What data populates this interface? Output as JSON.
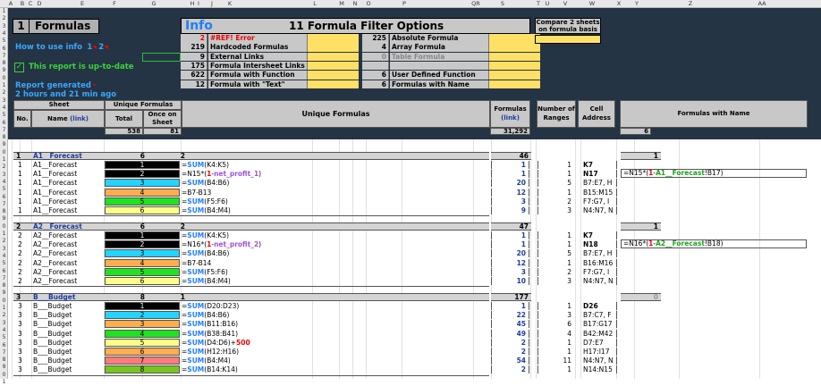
{
  "col_headers": [
    "A",
    "B",
    "C",
    "D",
    "E",
    "F",
    "G",
    "H",
    "I",
    "J",
    "K",
    "L",
    "M",
    "N",
    "O",
    "P",
    "QR",
    "S",
    "T",
    "U",
    "V",
    "W",
    "X",
    "Y",
    "Z",
    "AA"
  ],
  "row_headers": [
    "1",
    "2",
    "3",
    "4",
    "5",
    "6",
    "7",
    "8",
    "9",
    "0",
    "1",
    "2",
    "3",
    "4",
    "5",
    "6",
    "7",
    "8",
    "9",
    "0",
    "1",
    "2",
    "3",
    "4",
    "5",
    "6",
    "7",
    "8",
    "9",
    "0",
    "1",
    "2",
    "3",
    "4",
    "5",
    "6",
    "7",
    "8",
    "9",
    "0",
    "1",
    "2",
    "3",
    "4",
    "5",
    "6",
    "7",
    "8",
    "9",
    "0",
    "1"
  ],
  "title": {
    "number": "1",
    "text": "Formulas"
  },
  "how_to": {
    "label": "How to use info",
    "link1": "1",
    "link2": "2"
  },
  "status": {
    "check": "✓",
    "text": "This report is up-to-date"
  },
  "generated": {
    "line1": "Report generated",
    "line2": "2 hours and 21 min ago"
  },
  "info": {
    "icon": "Info",
    "title": "11 Formula Filter Options"
  },
  "filters_left": [
    {
      "count": "2",
      "label": "#REF! Error",
      "red": true
    },
    {
      "count": "219",
      "label": "Hardcoded Formulas"
    },
    {
      "count": "9",
      "label": "External Links"
    },
    {
      "count": "175",
      "label": "Formula Intersheet Links"
    },
    {
      "count": "622",
      "label": "Formula with Function"
    },
    {
      "count": "12",
      "label": "Formula with \"Text\""
    }
  ],
  "filters_right": [
    {
      "count": "225",
      "label": "Absolute Formula"
    },
    {
      "count": "4",
      "label": "Array Formula"
    },
    {
      "count": "0",
      "label": "Table Formula",
      "dim": true
    },
    {
      "count": "",
      "label": ""
    },
    {
      "count": "6",
      "label": "User Defined Function"
    },
    {
      "count": "6",
      "label": "Formulas with Name"
    }
  ],
  "compare": {
    "label": "Compare 2 sheets on formula basis"
  },
  "headers": {
    "sheet": "Sheet",
    "unique": "Unique Formulas",
    "no": "No.",
    "name": "Name",
    "link": "(link)",
    "total": "Total",
    "once": "Once on Sheet",
    "unique_formulas": "Unique Formulas",
    "formulas": "Formulas",
    "formulas_link": "(link)",
    "ranges": "Number of Ranges",
    "cell": "Cell Address",
    "named": "Formulas with Name"
  },
  "totals": {
    "total": "538",
    "once": "81",
    "formulas": "31,292",
    "named": "6"
  },
  "sections": [
    {
      "no": "1",
      "name": "A1__Forecast",
      "total": "6",
      "once": "2",
      "formulas": "46",
      "named": "1",
      "rows": [
        {
          "no": "1",
          "sheet": "A1__Forecast",
          "idx": "1",
          "color": "#000000",
          "tcolor": "#fff",
          "formula": [
            [
              "=",
              "d"
            ],
            [
              "SUM",
              "fn"
            ],
            [
              "(K4:K5)",
              "d"
            ]
          ],
          "count": "1",
          "ranges": "1",
          "cell": "K7",
          "bold": true
        },
        {
          "no": "1",
          "sheet": "A1__Forecast",
          "idx": "2",
          "color": "#000000",
          "tcolor": "#fff",
          "formula": [
            [
              "=N15*(",
              "d"
            ],
            [
              "1",
              "red"
            ],
            [
              "-",
              "d"
            ],
            [
              "net_profit_1",
              "pur"
            ],
            [
              ")",
              "d"
            ]
          ],
          "count": "1",
          "ranges": "1",
          "cell": "N17",
          "bold": true,
          "named": [
            [
              "=N15*(",
              "d"
            ],
            [
              "1",
              "red"
            ],
            [
              "-",
              "d"
            ],
            [
              "A1__Forecast",
              "gr"
            ],
            [
              "!B17)",
              "d"
            ]
          ]
        },
        {
          "no": "1",
          "sheet": "A1__Forecast",
          "idx": "3",
          "color": "#22d4ff",
          "tcolor": "#000",
          "formula": [
            [
              "=",
              "d"
            ],
            [
              "SUM",
              "fn"
            ],
            [
              "(B4:B6)",
              "d"
            ]
          ],
          "count": "20",
          "ranges": "5",
          "cell": "B7:E7, H"
        },
        {
          "no": "1",
          "sheet": "A1__Forecast",
          "idx": "4",
          "color": "#ffad4d",
          "tcolor": "#000",
          "formula": [
            [
              "=B7-B13",
              "d"
            ]
          ],
          "count": "12",
          "ranges": "1",
          "cell": "B15:M15"
        },
        {
          "no": "1",
          "sheet": "A1__Forecast",
          "idx": "5",
          "color": "#1fe31f",
          "tcolor": "#000",
          "formula": [
            [
              "=",
              "d"
            ],
            [
              "SUM",
              "fn"
            ],
            [
              "(F5:F6)",
              "d"
            ]
          ],
          "count": "3",
          "ranges": "2",
          "cell": "F7:G7, I"
        },
        {
          "no": "1",
          "sheet": "A1__Forecast",
          "idx": "6",
          "color": "#ffff88",
          "tcolor": "#000",
          "formula": [
            [
              "=",
              "d"
            ],
            [
              "SUM",
              "fn"
            ],
            [
              "(B4:M4)",
              "d"
            ]
          ],
          "count": "9",
          "ranges": "3",
          "cell": "N4:N7, N"
        }
      ]
    },
    {
      "no": "2",
      "name": "A2__Forecast",
      "total": "6",
      "once": "2",
      "formulas": "47",
      "named": "1",
      "rows": [
        {
          "no": "2",
          "sheet": "A2__Forecast",
          "idx": "1",
          "color": "#000000",
          "tcolor": "#fff",
          "formula": [
            [
              "=",
              "d"
            ],
            [
              "SUM",
              "fn"
            ],
            [
              "(K4:K5)",
              "d"
            ]
          ],
          "count": "1",
          "ranges": "1",
          "cell": "K7",
          "bold": true
        },
        {
          "no": "2",
          "sheet": "A2__Forecast",
          "idx": "2",
          "color": "#000000",
          "tcolor": "#fff",
          "formula": [
            [
              "=N16*(",
              "d"
            ],
            [
              "1",
              "red"
            ],
            [
              "-",
              "d"
            ],
            [
              "net_profit_2",
              "pur"
            ],
            [
              ")",
              "d"
            ]
          ],
          "count": "1",
          "ranges": "1",
          "cell": "N18",
          "bold": true,
          "named": [
            [
              "=N16*(",
              "d"
            ],
            [
              "1",
              "red"
            ],
            [
              "-",
              "d"
            ],
            [
              "A2__Forecast",
              "gr"
            ],
            [
              "!B18)",
              "d"
            ]
          ]
        },
        {
          "no": "2",
          "sheet": "A2__Forecast",
          "idx": "3",
          "color": "#22d4ff",
          "tcolor": "#000",
          "formula": [
            [
              "=",
              "d"
            ],
            [
              "SUM",
              "fn"
            ],
            [
              "(B4:B6)",
              "d"
            ]
          ],
          "count": "20",
          "ranges": "5",
          "cell": "B7:E7, H"
        },
        {
          "no": "2",
          "sheet": "A2__Forecast",
          "idx": "4",
          "color": "#ffad4d",
          "tcolor": "#000",
          "formula": [
            [
              "=B7-B14",
              "d"
            ]
          ],
          "count": "12",
          "ranges": "1",
          "cell": "B16:M16"
        },
        {
          "no": "2",
          "sheet": "A2__Forecast",
          "idx": "5",
          "color": "#1fe31f",
          "tcolor": "#000",
          "formula": [
            [
              "=",
              "d"
            ],
            [
              "SUM",
              "fn"
            ],
            [
              "(F5:F6)",
              "d"
            ]
          ],
          "count": "3",
          "ranges": "2",
          "cell": "F7:G7, I"
        },
        {
          "no": "2",
          "sheet": "A2__Forecast",
          "idx": "6",
          "color": "#ffff88",
          "tcolor": "#000",
          "formula": [
            [
              "=",
              "d"
            ],
            [
              "SUM",
              "fn"
            ],
            [
              "(B4:M4)",
              "d"
            ]
          ],
          "count": "10",
          "ranges": "3",
          "cell": "N4:N7, N"
        }
      ]
    },
    {
      "no": "3",
      "name": "B___Budget",
      "total": "8",
      "once": "1",
      "formulas": "177",
      "named": "0",
      "rows": [
        {
          "no": "3",
          "sheet": "B___Budget",
          "idx": "1",
          "color": "#000000",
          "tcolor": "#fff",
          "formula": [
            [
              "=",
              "d"
            ],
            [
              "SUM",
              "fn"
            ],
            [
              "(D20:D23)",
              "d"
            ]
          ],
          "count": "1",
          "ranges": "1",
          "cell": "D26",
          "bold": true
        },
        {
          "no": "3",
          "sheet": "B___Budget",
          "idx": "2",
          "color": "#22d4ff",
          "tcolor": "#000",
          "formula": [
            [
              "=",
              "d"
            ],
            [
              "SUM",
              "fn"
            ],
            [
              "(B4:B6)",
              "d"
            ]
          ],
          "count": "22",
          "ranges": "3",
          "cell": "B7:C7, F"
        },
        {
          "no": "3",
          "sheet": "B___Budget",
          "idx": "3",
          "color": "#ffad4d",
          "tcolor": "#000",
          "formula": [
            [
              "=",
              "d"
            ],
            [
              "SUM",
              "fn"
            ],
            [
              "(B11:B16)",
              "d"
            ]
          ],
          "count": "45",
          "ranges": "6",
          "cell": "B17:G17"
        },
        {
          "no": "3",
          "sheet": "B___Budget",
          "idx": "4",
          "color": "#1fe31f",
          "tcolor": "#000",
          "formula": [
            [
              "=",
              "d"
            ],
            [
              "SUM",
              "fn"
            ],
            [
              "(B38:B41)",
              "d"
            ]
          ],
          "count": "49",
          "ranges": "4",
          "cell": "B42:M42"
        },
        {
          "no": "3",
          "sheet": "B___Budget",
          "idx": "5",
          "color": "#ffff88",
          "tcolor": "#000",
          "formula": [
            [
              "=",
              "d"
            ],
            [
              "SUM",
              "fn"
            ],
            [
              "(D4:D6)+",
              "d"
            ],
            [
              "500",
              "red"
            ]
          ],
          "count": "2",
          "ranges": "1",
          "cell": "D7:E7"
        },
        {
          "no": "3",
          "sheet": "B___Budget",
          "idx": "6",
          "color": "#ffad4d",
          "tcolor": "#000",
          "formula": [
            [
              "=",
              "d"
            ],
            [
              "SUM",
              "fn"
            ],
            [
              "(H12:H16)",
              "d"
            ]
          ],
          "count": "2",
          "ranges": "1",
          "cell": "H17:I17"
        },
        {
          "no": "3",
          "sheet": "B___Budget",
          "idx": "7",
          "color": "#ff7a7a",
          "tcolor": "#000",
          "formula": [
            [
              "=",
              "d"
            ],
            [
              "SUM",
              "fn"
            ],
            [
              "(B4:M4)",
              "d"
            ]
          ],
          "count": "54",
          "ranges": "11",
          "cell": "N4:N7, N"
        },
        {
          "no": "3",
          "sheet": "B___Budget",
          "idx": "8",
          "color": "#7ac41f",
          "tcolor": "#000",
          "formula": [
            [
              "=",
              "d"
            ],
            [
              "SUM",
              "fn"
            ],
            [
              "(B14:K14)",
              "d"
            ]
          ],
          "count": "2",
          "ranges": "1",
          "cell": "N14:N15"
        }
      ]
    }
  ]
}
